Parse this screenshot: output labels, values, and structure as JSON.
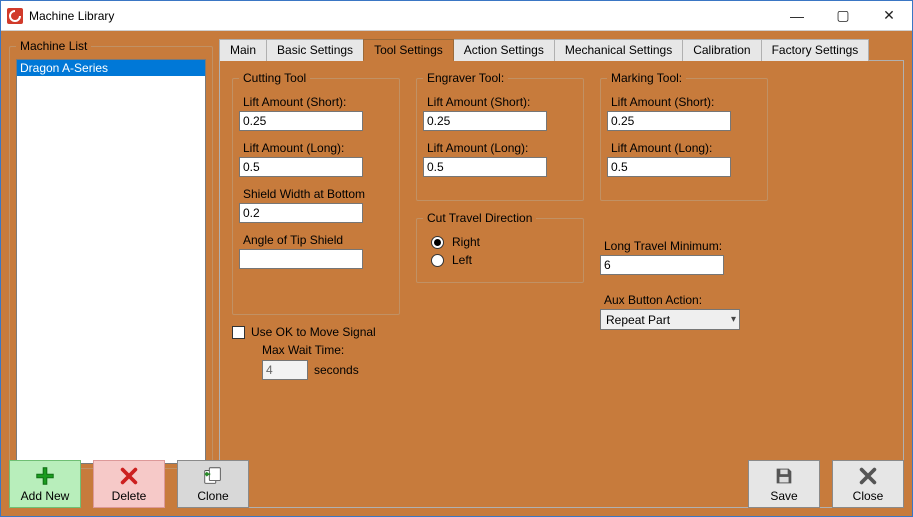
{
  "window": {
    "title": "Machine Library"
  },
  "win_buttons": {
    "min": "—",
    "max": "▢",
    "close": "✕"
  },
  "machine_list": {
    "legend": "Machine List",
    "items": [
      "Dragon A-Series"
    ],
    "selected": 0
  },
  "tabs": [
    "Main",
    "Basic Settings",
    "Tool Settings",
    "Action Settings",
    "Mechanical Settings",
    "Calibration",
    "Factory Settings"
  ],
  "active_tab": 2,
  "cutting_tool": {
    "legend": "Cutting Tool",
    "lift_short_label": "Lift Amount (Short):",
    "lift_short": "0.25",
    "lift_long_label": "Lift Amount (Long):",
    "lift_long": "0.5",
    "shield_width_label": "Shield Width at Bottom",
    "shield_width": "0.2",
    "angle_label": "Angle of Tip Shield",
    "angle": ""
  },
  "engraver_tool": {
    "legend": "Engraver Tool:",
    "lift_short_label": "Lift Amount (Short):",
    "lift_short": "0.25",
    "lift_long_label": "Lift Amount (Long):",
    "lift_long": "0.5"
  },
  "marking_tool": {
    "legend": "Marking Tool:",
    "lift_short_label": "Lift Amount (Short):",
    "lift_short": "0.25",
    "lift_long_label": "Lift Amount (Long):",
    "lift_long": "0.5"
  },
  "cut_travel": {
    "legend": "Cut Travel Direction",
    "right_label": "Right",
    "left_label": "Left",
    "selected": "right"
  },
  "ok_signal": {
    "check_label": "Use OK to Move Signal",
    "checked": false,
    "max_wait_label": "Max Wait Time:",
    "max_wait": "4",
    "seconds_label": "seconds"
  },
  "long_travel": {
    "label": "Long Travel Minimum:",
    "value": "6"
  },
  "aux_button": {
    "label": "Aux Button Action:",
    "value": "Repeat Part"
  },
  "buttons": {
    "add": "Add New",
    "delete": "Delete",
    "clone": "Clone",
    "save": "Save",
    "close": "Close"
  }
}
